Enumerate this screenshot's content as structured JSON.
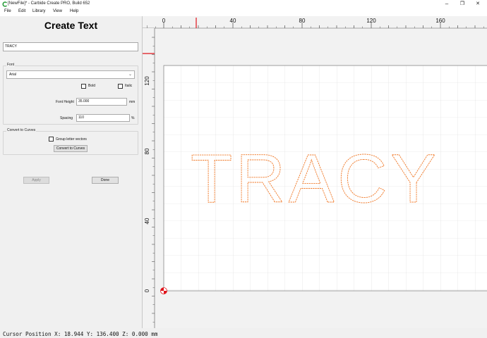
{
  "window": {
    "title": "[NewFile]* - Carbide Create PRO, Build 652",
    "controls": [
      "–",
      "❐",
      "✕"
    ]
  },
  "menu": [
    "File",
    "Edit",
    "Library",
    "View",
    "Help"
  ],
  "panel": {
    "heading": "Create Text",
    "text_value": "TRACY",
    "font_group": {
      "title": "Font",
      "font_select": "Arial",
      "bold_label": "Bold",
      "bold_checked": false,
      "italic_label": "Italic",
      "italic_checked": false,
      "font_height_label": "Font Height",
      "font_height_value": "35.000",
      "font_height_unit": "mm",
      "spacing_label": "Spacing",
      "spacing_value": "110",
      "spacing_unit": "%"
    },
    "convert_group": {
      "title": "Convert to Curves",
      "group_vectors_label": "Group letter vectors",
      "group_vectors_checked": false,
      "convert_button": "Convert to Curves"
    },
    "apply_button": "Apply",
    "done_button": "Done"
  },
  "canvas": {
    "text": "TRACY",
    "x_ticks": [
      "0",
      "40",
      "80",
      "120",
      "160"
    ],
    "y_ticks": [
      "120",
      "80",
      "40",
      "0"
    ],
    "colors": {
      "outline": "#f07a2a",
      "stock_bg": "#ffffff",
      "grid": "#d9d9d9",
      "marker": "#e0141b"
    }
  },
  "status": {
    "text": "Cursor Position X: 18.944 Y: 136.400 Z: 0.000 mm"
  }
}
